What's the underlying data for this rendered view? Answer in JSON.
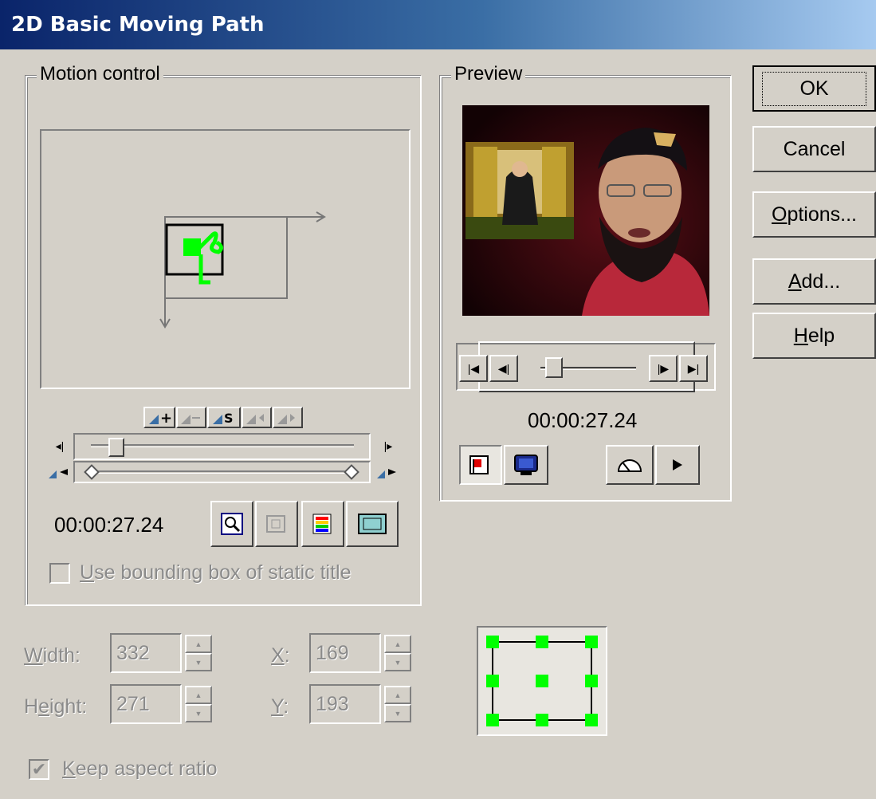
{
  "window": {
    "title": "2D Basic Moving Path"
  },
  "motion": {
    "legend": "Motion control",
    "time": "00:00:27.24",
    "bounding_box_label_mnemonic": "U",
    "bounding_box_label_rest": "se bounding box of static title"
  },
  "preview": {
    "legend": "Preview",
    "time": "00:00:27.24"
  },
  "buttons": {
    "ok": "OK",
    "cancel": "Cancel",
    "options_mnemonic": "O",
    "options_rest": "ptions...",
    "add_mnemonic": "A",
    "add_rest": "dd...",
    "help_mnemonic": "H",
    "help_rest": "elp"
  },
  "size": {
    "width_mnemonic": "W",
    "width_rest": "idth:",
    "width_value": "332",
    "height_mnemonic": "e",
    "height_pre": "H",
    "height_rest": "ight:",
    "height_value": "271",
    "x_label": "X",
    "x_colon": ":",
    "x_value": "169",
    "y_label": "Y",
    "y_colon": ":",
    "y_value": "193"
  },
  "keep_aspect": {
    "mnemonic": "K",
    "rest": "eep aspect ratio",
    "checked": true
  },
  "colors": {
    "title_start": "#0a246a",
    "title_end": "#a6caf0",
    "path_green": "#00ff00",
    "dialog_bg": "#d4d0c8"
  }
}
